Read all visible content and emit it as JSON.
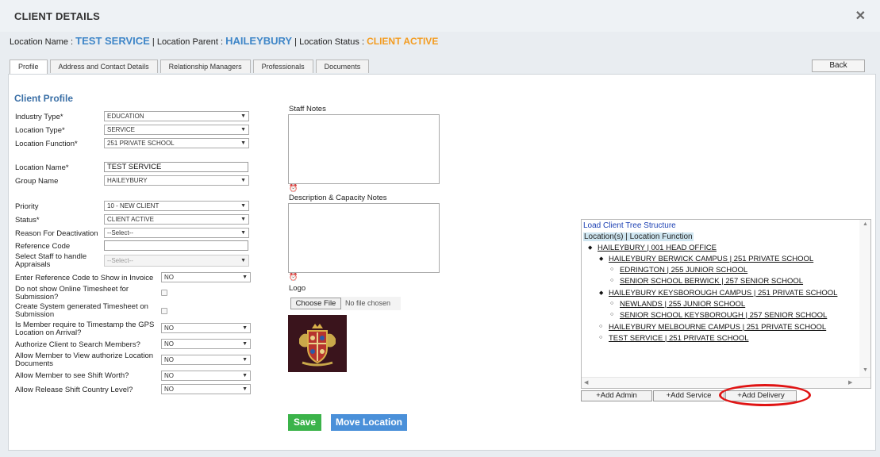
{
  "header": {
    "title": "CLIENT DETAILS",
    "close_icon": "close-icon"
  },
  "location": {
    "name_label": "Location Name :",
    "name_value": "TEST SERVICE",
    "parent_label": "| Location Parent :",
    "parent_value": "HAILEYBURY",
    "status_label": "| Location Status :",
    "status_value": "CLIENT ACTIVE"
  },
  "tabs": [
    {
      "label": "Profile"
    },
    {
      "label": "Address and Contact Details"
    },
    {
      "label": "Relationship Managers"
    },
    {
      "label": "Professionals"
    },
    {
      "label": "Documents"
    }
  ],
  "back_label": "Back",
  "profile": {
    "title": "Client Profile",
    "fields": {
      "industry_type": {
        "label": "Industry Type*",
        "value": "EDUCATION"
      },
      "location_type": {
        "label": "Location Type*",
        "value": "SERVICE"
      },
      "location_function": {
        "label": "Location Function*",
        "value": "251 PRIVATE SCHOOL"
      },
      "location_name": {
        "label": "Location Name*",
        "value": "TEST SERVICE"
      },
      "group_name": {
        "label": "Group Name",
        "value": "HAILEYBURY"
      },
      "priority": {
        "label": "Priority",
        "value": "10 - NEW CLIENT"
      },
      "status": {
        "label": "Status*",
        "value": "CLIENT ACTIVE"
      },
      "reason": {
        "label": "Reason For Deactivation",
        "value": "--Select--"
      },
      "reference_code": {
        "label": "Reference Code",
        "value": ""
      },
      "staff_appraisals": {
        "label": "Select Staff to handle Appraisals",
        "value": "--Select--"
      },
      "ref_invoice": {
        "label": "Enter Reference Code to Show in Invoice",
        "value": "NO"
      },
      "online_timesheet": {
        "label": "Do not show Online Timesheet for Submission?"
      },
      "system_timesheet": {
        "label": "Create System generated Timesheet on Submission"
      },
      "gps_timestamp": {
        "label": "Is Member require to Timestamp the GPS Location on Arrival?",
        "value": "NO"
      },
      "authorize_search": {
        "label": "Authorize Client to Search Members?",
        "value": "NO"
      },
      "view_documents": {
        "label": "Allow Member to View authorize Location Documents",
        "value": "NO"
      },
      "shift_worth": {
        "label": "Allow Member to see Shift Worth?",
        "value": "NO"
      },
      "shift_country": {
        "label": "Allow Release Shift Country Level?",
        "value": "NO"
      }
    }
  },
  "notes": {
    "staff_notes_label": "Staff Notes",
    "capacity_notes_label": "Description & Capacity Notes",
    "logo_label": "Logo",
    "choose_file_label": "Choose File",
    "file_status": "No file chosen"
  },
  "buttons": {
    "save": "Save",
    "move_location": "Move Location"
  },
  "tree": {
    "load_label": "Load Client Tree Structure",
    "header": "Location(s) | Location Function",
    "nodes": [
      "HAILEYBURY | 001 HEAD OFFICE",
      "HAILEYBURY BERWICK CAMPUS | 251 PRIVATE SCHOOL",
      "EDRINGTON | 255 JUNIOR SCHOOL",
      "SENIOR SCHOOL BERWICK | 257 SENIOR SCHOOL",
      "HAILEYBURY KEYSBOROUGH CAMPUS | 251 PRIVATE SCHOOL",
      "NEWLANDS | 255 JUNIOR SCHOOL",
      "SENIOR SCHOOL KEYSBOROUGH | 257 SENIOR SCHOOL",
      "HAILEYBURY MELBOURNE CAMPUS | 251 PRIVATE SCHOOL",
      "TEST SERVICE | 251 PRIVATE SCHOOL"
    ],
    "buttons": {
      "add_admin": "+Add Admin",
      "add_service": "+Add Service",
      "add_delivery": "+Add Delivery"
    }
  },
  "colors": {
    "accent_blue": "#3f86c8",
    "status_orange": "#f39c21",
    "save_green": "#3bb34a",
    "move_blue": "#4a90d9",
    "highlight_red": "#e01414"
  }
}
